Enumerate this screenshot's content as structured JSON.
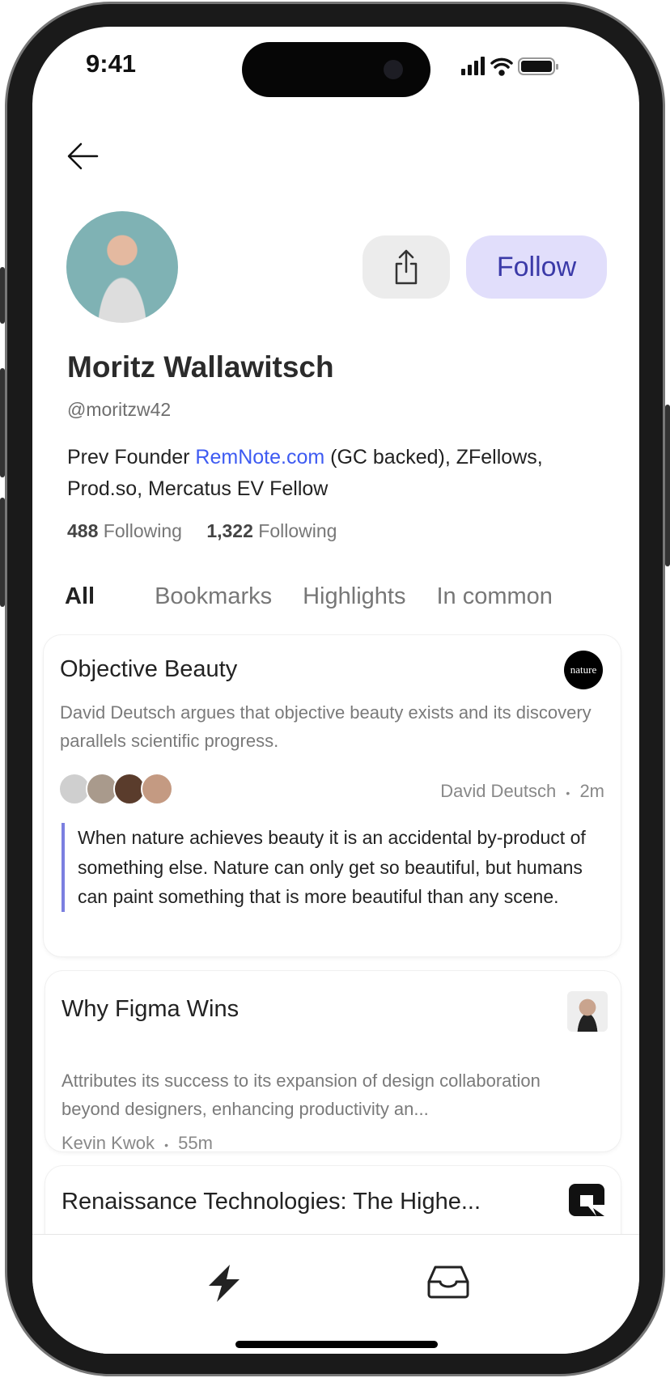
{
  "status_bar": {
    "time": "9:41"
  },
  "profile": {
    "name": "Moritz Wallawitsch",
    "handle": "@moritzw42",
    "bio_prefix": "Prev Founder ",
    "bio_link": "RemNote.com",
    "bio_suffix": " (GC backed), ZFellows, Prod.so, Mercatus EV Fellow",
    "following_count": "488",
    "following_label": "Following",
    "followers_count": "1,322",
    "followers_label": "Following",
    "follow_label": "Follow"
  },
  "colors": {
    "accent": "#3e5bf2",
    "follow_bg": "#e1defb",
    "follow_text": "#3b3aa8",
    "quote_bar": "#7b7fe0"
  },
  "tabs": [
    {
      "label": "All",
      "active": true
    },
    {
      "label": "Bookmarks"
    },
    {
      "label": "Highlights"
    },
    {
      "label": "In common"
    }
  ],
  "cards": [
    {
      "title": "Objective Beauty",
      "source_logo": "nature",
      "description": "David Deutsch argues that objective beauty exists and its discovery parallels scientific progress.",
      "author": "David Deutsch",
      "time": "2m",
      "quote": "When nature achieves beauty it is an accidental by-product of something else. Nature can only get so beautiful, but humans can paint something that is more beautiful than any scene."
    },
    {
      "title": "Why Figma Wins",
      "description": "Attributes its success to its expansion of design collaboration beyond designers, enhancing productivity an...",
      "author": "Kevin Kwok",
      "time": "55m"
    },
    {
      "title": "Renaissance Technologies: The Highe..."
    }
  ],
  "separator": "•",
  "bottom_nav": [
    {
      "icon": "lightning-icon"
    },
    {
      "icon": "inbox-icon"
    }
  ]
}
